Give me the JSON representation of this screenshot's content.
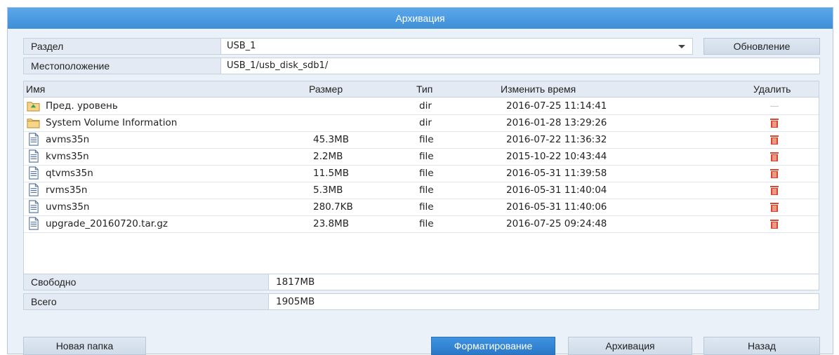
{
  "window": {
    "title": "Архивация"
  },
  "partition": {
    "label": "Раздел",
    "value": "USB_1"
  },
  "refresh_button": "Обновление",
  "location": {
    "label": "Местоположение",
    "value": "USB_1/usb_disk_sdb1/"
  },
  "table": {
    "columns": {
      "name": "Имя",
      "size": "Размер",
      "type": "Тип",
      "modified": "Изменить время",
      "delete": "Удалить"
    },
    "rows": [
      {
        "name": "Пред. уровень",
        "size": "",
        "type": "dir",
        "modified": "2016-07-25 11:14:41",
        "icon": "up-folder-icon",
        "deletable": false
      },
      {
        "name": "System Volume Information",
        "size": "",
        "type": "dir",
        "modified": "2016-01-28 13:29:26",
        "icon": "folder-icon",
        "deletable": true
      },
      {
        "name": "avms35n",
        "size": "45.3MB",
        "type": "file",
        "modified": "2016-07-22 11:36:32",
        "icon": "file-icon",
        "deletable": true
      },
      {
        "name": "kvms35n",
        "size": "2.2MB",
        "type": "file",
        "modified": "2015-10-22 10:43:44",
        "icon": "file-icon",
        "deletable": true
      },
      {
        "name": "qtvms35n",
        "size": "11.5MB",
        "type": "file",
        "modified": "2016-05-31 11:39:58",
        "icon": "file-icon",
        "deletable": true
      },
      {
        "name": "rvms35n",
        "size": "5.3MB",
        "type": "file",
        "modified": "2016-05-31 11:40:04",
        "icon": "file-icon",
        "deletable": true
      },
      {
        "name": "uvms35n",
        "size": "280.7KB",
        "type": "file",
        "modified": "2016-05-31 11:40:06",
        "icon": "file-icon",
        "deletable": true
      },
      {
        "name": "upgrade_20160720.tar.gz",
        "size": "23.8MB",
        "type": "file",
        "modified": "2016-07-25 09:24:48",
        "icon": "file-icon",
        "deletable": true
      }
    ]
  },
  "free": {
    "label": "Свободно",
    "value": "1817MB"
  },
  "total": {
    "label": "Всего",
    "value": "1905MB"
  },
  "buttons": {
    "new_folder": "Новая папка",
    "format": "Форматирование",
    "backup": "Архивация",
    "back": "Назад"
  },
  "colors": {
    "title_bar": "#3f8fd8",
    "primary_button": "#2a78c8",
    "delete_icon": "#d9472b"
  }
}
